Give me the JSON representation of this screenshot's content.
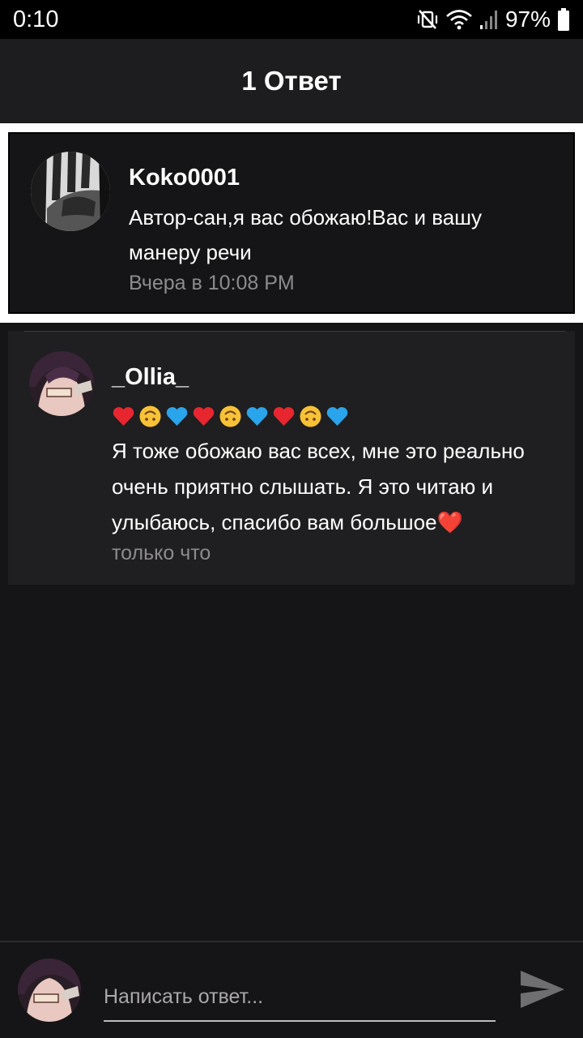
{
  "status_bar": {
    "time": "0:10",
    "battery": "97%",
    "icons": [
      "vibrate-off-icon",
      "wifi-icon",
      "signal-icon",
      "battery-icon"
    ]
  },
  "header": {
    "title": "1 Ответ"
  },
  "original_comment": {
    "author": "Koko0001",
    "text_line1": "Автор-сан,я вас обожаю!Вас и вашу",
    "text_line2": "манеру речи",
    "time": "Вчера в 10:08 PM"
  },
  "reply": {
    "author": "_Ollia_",
    "emojis": [
      "❤️",
      "🙃",
      "💙",
      "❤️",
      "🙃",
      "💙",
      "❤️",
      "🙃",
      "💙"
    ],
    "text_line1": "Я тоже обожаю вас всех, мне это реально",
    "text_line2": "очень приятно слышать. Я это читаю и",
    "text_line3": "улыбаюсь, спасибо вам большое❤️",
    "time": "только что"
  },
  "composer": {
    "placeholder": "Написать ответ...",
    "send_icon": "send-icon"
  },
  "colors": {
    "background": "#151416",
    "header": "#1d1c1e",
    "reply_card": "#1f1e20",
    "muted_text": "#8d8b8e",
    "highlight_border": "#ffffff"
  }
}
